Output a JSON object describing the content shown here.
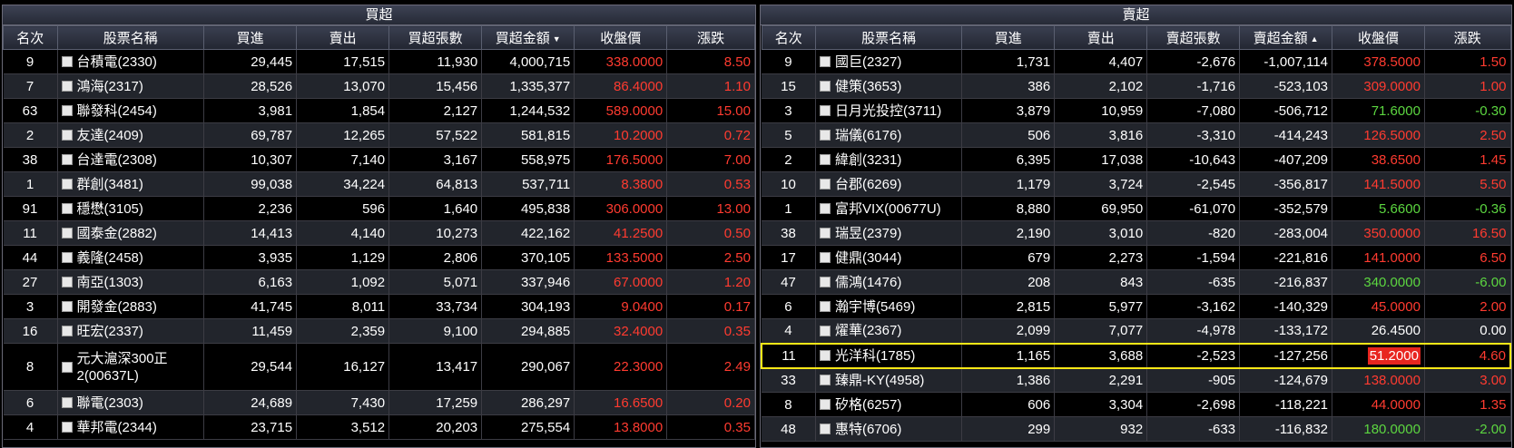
{
  "buy_panel": {
    "title": "買超",
    "headers": [
      "名次",
      "股票名稱",
      "買進",
      "賣出",
      "買超張數",
      "買超金額",
      "收盤價",
      "漲跌"
    ],
    "sort_indicator": "▼",
    "rows": [
      {
        "rank": "9",
        "name": "台積電(2330)",
        "buy": "29,445",
        "sell": "17,515",
        "qty": "11,930",
        "amount": "4,000,715",
        "close": "338.0000",
        "change": "8.50"
      },
      {
        "rank": "7",
        "name": "鴻海(2317)",
        "buy": "28,526",
        "sell": "13,070",
        "qty": "15,456",
        "amount": "1,335,377",
        "close": "86.4000",
        "change": "1.10"
      },
      {
        "rank": "63",
        "name": "聯發科(2454)",
        "buy": "3,981",
        "sell": "1,854",
        "qty": "2,127",
        "amount": "1,244,532",
        "close": "589.0000",
        "change": "15.00"
      },
      {
        "rank": "2",
        "name": "友達(2409)",
        "buy": "69,787",
        "sell": "12,265",
        "qty": "57,522",
        "amount": "581,815",
        "close": "10.2000",
        "change": "0.72"
      },
      {
        "rank": "38",
        "name": "台達電(2308)",
        "buy": "10,307",
        "sell": "7,140",
        "qty": "3,167",
        "amount": "558,975",
        "close": "176.5000",
        "change": "7.00"
      },
      {
        "rank": "1",
        "name": "群創(3481)",
        "buy": "99,038",
        "sell": "34,224",
        "qty": "64,813",
        "amount": "537,711",
        "close": "8.3800",
        "change": "0.53"
      },
      {
        "rank": "91",
        "name": "穩懋(3105)",
        "buy": "2,236",
        "sell": "596",
        "qty": "1,640",
        "amount": "495,838",
        "close": "306.0000",
        "change": "13.00"
      },
      {
        "rank": "11",
        "name": "國泰金(2882)",
        "buy": "14,413",
        "sell": "4,140",
        "qty": "10,273",
        "amount": "422,162",
        "close": "41.2500",
        "change": "0.50"
      },
      {
        "rank": "44",
        "name": "義隆(2458)",
        "buy": "3,935",
        "sell": "1,129",
        "qty": "2,806",
        "amount": "370,105",
        "close": "133.5000",
        "change": "2.50"
      },
      {
        "rank": "27",
        "name": "南亞(1303)",
        "buy": "6,163",
        "sell": "1,092",
        "qty": "5,071",
        "amount": "337,946",
        "close": "67.0000",
        "change": "1.20"
      },
      {
        "rank": "3",
        "name": "開發金(2883)",
        "buy": "41,745",
        "sell": "8,011",
        "qty": "33,734",
        "amount": "304,193",
        "close": "9.0400",
        "change": "0.17"
      },
      {
        "rank": "16",
        "name": "旺宏(2337)",
        "buy": "11,459",
        "sell": "2,359",
        "qty": "9,100",
        "amount": "294,885",
        "close": "32.4000",
        "change": "0.35"
      },
      {
        "rank": "8",
        "name": "元大滬深300正2(00637L)",
        "buy": "29,544",
        "sell": "16,127",
        "qty": "13,417",
        "amount": "290,067",
        "close": "22.3000",
        "change": "2.49"
      },
      {
        "rank": "6",
        "name": "聯電(2303)",
        "buy": "24,689",
        "sell": "7,430",
        "qty": "17,259",
        "amount": "286,297",
        "close": "16.6500",
        "change": "0.20"
      },
      {
        "rank": "4",
        "name": "華邦電(2344)",
        "buy": "23,715",
        "sell": "3,512",
        "qty": "20,203",
        "amount": "275,554",
        "close": "13.8000",
        "change": "0.35"
      }
    ]
  },
  "sell_panel": {
    "title": "賣超",
    "headers": [
      "名次",
      "股票名稱",
      "買進",
      "賣出",
      "賣超張數",
      "賣超金額",
      "收盤價",
      "漲跌"
    ],
    "sort_indicator": "▲",
    "rows": [
      {
        "rank": "9",
        "name": "國巨(2327)",
        "buy": "1,731",
        "sell": "4,407",
        "qty": "-2,676",
        "amount": "-1,007,114",
        "close": "378.5000",
        "change": "1.50",
        "color": "red"
      },
      {
        "rank": "15",
        "name": "健策(3653)",
        "buy": "386",
        "sell": "2,102",
        "qty": "-1,716",
        "amount": "-523,103",
        "close": "309.0000",
        "change": "1.00",
        "color": "red"
      },
      {
        "rank": "3",
        "name": "日月光投控(3711)",
        "buy": "3,879",
        "sell": "10,959",
        "qty": "-7,080",
        "amount": "-506,712",
        "close": "71.6000",
        "change": "-0.30",
        "color": "green"
      },
      {
        "rank": "5",
        "name": "瑞儀(6176)",
        "buy": "506",
        "sell": "3,816",
        "qty": "-3,310",
        "amount": "-414,243",
        "close": "126.5000",
        "change": "2.50",
        "color": "red"
      },
      {
        "rank": "2",
        "name": "緯創(3231)",
        "buy": "6,395",
        "sell": "17,038",
        "qty": "-10,643",
        "amount": "-407,209",
        "close": "38.6500",
        "change": "1.45",
        "color": "red"
      },
      {
        "rank": "10",
        "name": "台郡(6269)",
        "buy": "1,179",
        "sell": "3,724",
        "qty": "-2,545",
        "amount": "-356,817",
        "close": "141.5000",
        "change": "5.50",
        "color": "red"
      },
      {
        "rank": "1",
        "name": "富邦VIX(00677U)",
        "buy": "8,880",
        "sell": "69,950",
        "qty": "-61,070",
        "amount": "-352,579",
        "close": "5.6600",
        "change": "-0.36",
        "color": "green"
      },
      {
        "rank": "38",
        "name": "瑞昱(2379)",
        "buy": "2,190",
        "sell": "3,010",
        "qty": "-820",
        "amount": "-283,004",
        "close": "350.0000",
        "change": "16.50",
        "color": "red"
      },
      {
        "rank": "17",
        "name": "健鼎(3044)",
        "buy": "679",
        "sell": "2,273",
        "qty": "-1,594",
        "amount": "-221,816",
        "close": "141.0000",
        "change": "6.50",
        "color": "red"
      },
      {
        "rank": "47",
        "name": "儒鴻(1476)",
        "buy": "208",
        "sell": "843",
        "qty": "-635",
        "amount": "-216,837",
        "close": "340.0000",
        "change": "-6.00",
        "color": "green"
      },
      {
        "rank": "6",
        "name": "瀚宇博(5469)",
        "buy": "2,815",
        "sell": "5,977",
        "qty": "-3,162",
        "amount": "-140,329",
        "close": "45.0000",
        "change": "2.00",
        "color": "red"
      },
      {
        "rank": "4",
        "name": "燿華(2367)",
        "buy": "2,099",
        "sell": "7,077",
        "qty": "-4,978",
        "amount": "-133,172",
        "close": "26.4500",
        "change": "0.00",
        "color": "white"
      },
      {
        "rank": "11",
        "name": "光洋科(1785)",
        "buy": "1,165",
        "sell": "3,688",
        "qty": "-2,523",
        "amount": "-127,256",
        "close": "51.2000",
        "change": "4.60",
        "color": "red",
        "highlight": true
      },
      {
        "rank": "33",
        "name": "臻鼎-KY(4958)",
        "buy": "1,386",
        "sell": "2,291",
        "qty": "-905",
        "amount": "-124,679",
        "close": "138.0000",
        "change": "3.00",
        "color": "red"
      },
      {
        "rank": "8",
        "name": "矽格(6257)",
        "buy": "606",
        "sell": "3,304",
        "qty": "-2,698",
        "amount": "-118,221",
        "close": "44.0000",
        "change": "1.35",
        "color": "red"
      },
      {
        "rank": "48",
        "name": "惠特(6706)",
        "buy": "299",
        "sell": "932",
        "qty": "-633",
        "amount": "-116,832",
        "close": "180.0000",
        "change": "-2.00",
        "color": "green"
      }
    ]
  },
  "colors": {
    "up": "#ff3b30",
    "down": "#5cd640",
    "flat": "#ffffff",
    "highlight_border": "#ffe817"
  }
}
